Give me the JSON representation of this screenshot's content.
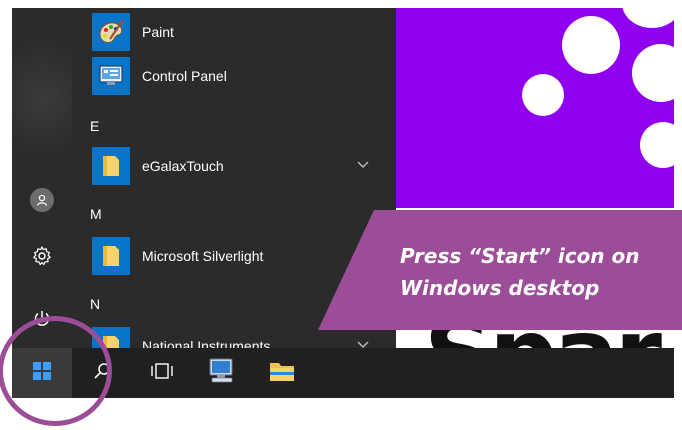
{
  "colors": {
    "start_bg": "#2b2b2b",
    "tile_blue": "#0a74c9",
    "taskbar": "#202020",
    "desktop_purple": "#8f00ee",
    "callout": "#9c4d97"
  },
  "start_menu": {
    "rail": {
      "account_icon": "user-icon",
      "settings_icon": "gear-icon",
      "power_icon": "power-icon"
    },
    "apps": [
      {
        "label": "Paint",
        "icon": "paint-palette-icon"
      },
      {
        "label": "Control Panel",
        "icon": "control-panel-icon"
      },
      {
        "label": "eGalaxTouch",
        "icon": "folder-icon"
      },
      {
        "label": "Microsoft Silverlight",
        "icon": "folder-icon"
      },
      {
        "label": "National Instruments",
        "icon": "folder-icon"
      }
    ],
    "letters": [
      "E",
      "M",
      "N"
    ]
  },
  "taskbar": {
    "items": [
      "windows-logo-icon",
      "search-icon",
      "task-view-icon",
      "computer-icon",
      "file-explorer-icon"
    ]
  },
  "desktop": {
    "wordmark": "Spar"
  },
  "callout": {
    "line1": "Press “Start” icon on",
    "line2": "Windows desktop"
  }
}
